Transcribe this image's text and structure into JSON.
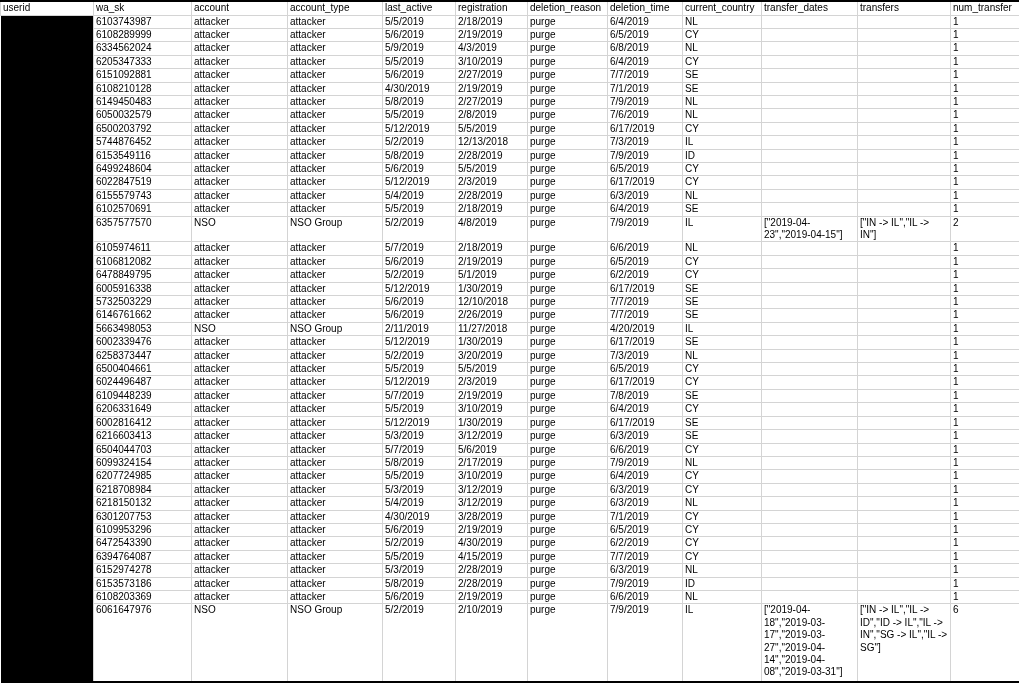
{
  "columns": [
    "userid",
    "wa_sk",
    "account",
    "account_type",
    "last_active",
    "registration",
    "deletion_reason",
    "deletion_time",
    "current_country",
    "transfer_dates",
    "transfers",
    "num_transfer"
  ],
  "rows": [
    {
      "wa_sk": "6103743987",
      "account": "attacker",
      "account_type": "attacker",
      "last_active": "5/5/2019",
      "registration": "2/18/2019",
      "deletion_reason": "purge",
      "deletion_time": "6/4/2019",
      "current_country": "NL",
      "num_transfer": "1"
    },
    {
      "wa_sk": "6108289999",
      "account": "attacker",
      "account_type": "attacker",
      "last_active": "5/6/2019",
      "registration": "2/19/2019",
      "deletion_reason": "purge",
      "deletion_time": "6/5/2019",
      "current_country": "CY",
      "num_transfer": "1"
    },
    {
      "wa_sk": "6334562024",
      "account": "attacker",
      "account_type": "attacker",
      "last_active": "5/9/2019",
      "registration": "4/3/2019",
      "deletion_reason": "purge",
      "deletion_time": "6/8/2019",
      "current_country": "NL",
      "num_transfer": "1"
    },
    {
      "wa_sk": "6205347333",
      "account": "attacker",
      "account_type": "attacker",
      "last_active": "5/5/2019",
      "registration": "3/10/2019",
      "deletion_reason": "purge",
      "deletion_time": "6/4/2019",
      "current_country": "CY",
      "num_transfer": "1"
    },
    {
      "wa_sk": "6151092881",
      "account": "attacker",
      "account_type": "attacker",
      "last_active": "5/6/2019",
      "registration": "2/27/2019",
      "deletion_reason": "purge",
      "deletion_time": "7/7/2019",
      "current_country": "SE",
      "num_transfer": "1"
    },
    {
      "wa_sk": "6108210128",
      "account": "attacker",
      "account_type": "attacker",
      "last_active": "4/30/2019",
      "registration": "2/19/2019",
      "deletion_reason": "purge",
      "deletion_time": "7/1/2019",
      "current_country": "SE",
      "num_transfer": "1"
    },
    {
      "wa_sk": "6149450483",
      "account": "attacker",
      "account_type": "attacker",
      "last_active": "5/8/2019",
      "registration": "2/27/2019",
      "deletion_reason": "purge",
      "deletion_time": "7/9/2019",
      "current_country": "NL",
      "num_transfer": "1"
    },
    {
      "wa_sk": "6050032579",
      "account": "attacker",
      "account_type": "attacker",
      "last_active": "5/5/2019",
      "registration": "2/8/2019",
      "deletion_reason": "purge",
      "deletion_time": "7/6/2019",
      "current_country": "NL",
      "num_transfer": "1"
    },
    {
      "wa_sk": "6500203792",
      "account": "attacker",
      "account_type": "attacker",
      "last_active": "5/12/2019",
      "registration": "5/5/2019",
      "deletion_reason": "purge",
      "deletion_time": "6/17/2019",
      "current_country": "CY",
      "num_transfer": "1"
    },
    {
      "wa_sk": "5744876452",
      "account": "attacker",
      "account_type": "attacker",
      "last_active": "5/2/2019",
      "registration": "12/13/2018",
      "deletion_reason": "purge",
      "deletion_time": "7/3/2019",
      "current_country": "IL",
      "num_transfer": "1"
    },
    {
      "wa_sk": "6153549116",
      "account": "attacker",
      "account_type": "attacker",
      "last_active": "5/8/2019",
      "registration": "2/28/2019",
      "deletion_reason": "purge",
      "deletion_time": "7/9/2019",
      "current_country": "ID",
      "num_transfer": "1"
    },
    {
      "wa_sk": "6499248604",
      "account": "attacker",
      "account_type": "attacker",
      "last_active": "5/6/2019",
      "registration": "5/5/2019",
      "deletion_reason": "purge",
      "deletion_time": "6/5/2019",
      "current_country": "CY",
      "num_transfer": "1"
    },
    {
      "wa_sk": "6022847519",
      "account": "attacker",
      "account_type": "attacker",
      "last_active": "5/12/2019",
      "registration": "2/3/2019",
      "deletion_reason": "purge",
      "deletion_time": "6/17/2019",
      "current_country": "CY",
      "num_transfer": "1"
    },
    {
      "wa_sk": "6155579743",
      "account": "attacker",
      "account_type": "attacker",
      "last_active": "5/4/2019",
      "registration": "2/28/2019",
      "deletion_reason": "purge",
      "deletion_time": "6/3/2019",
      "current_country": "NL",
      "num_transfer": "1"
    },
    {
      "wa_sk": "6102570691",
      "account": "attacker",
      "account_type": "attacker",
      "last_active": "5/5/2019",
      "registration": "2/18/2019",
      "deletion_reason": "purge",
      "deletion_time": "6/4/2019",
      "current_country": "SE",
      "num_transfer": "1"
    },
    {
      "wa_sk": "6357577570",
      "account": "NSO",
      "account_type": "NSO Group",
      "last_active": "5/2/2019",
      "registration": "4/8/2019",
      "deletion_reason": "purge",
      "deletion_time": "7/9/2019",
      "current_country": "IL",
      "transfer_dates": "[\"2019-04-23\",\"2019-04-15\"]",
      "transfers": "[\"IN -> IL\",\"IL -> IN\"]",
      "num_transfer": "2"
    },
    {
      "wa_sk": "6105974611",
      "account": "attacker",
      "account_type": "attacker",
      "last_active": "5/7/2019",
      "registration": "2/18/2019",
      "deletion_reason": "purge",
      "deletion_time": "6/6/2019",
      "current_country": "NL",
      "num_transfer": "1"
    },
    {
      "wa_sk": "6106812082",
      "account": "attacker",
      "account_type": "attacker",
      "last_active": "5/6/2019",
      "registration": "2/19/2019",
      "deletion_reason": "purge",
      "deletion_time": "6/5/2019",
      "current_country": "CY",
      "num_transfer": "1"
    },
    {
      "wa_sk": "6478849795",
      "account": "attacker",
      "account_type": "attacker",
      "last_active": "5/2/2019",
      "registration": "5/1/2019",
      "deletion_reason": "purge",
      "deletion_time": "6/2/2019",
      "current_country": "CY",
      "num_transfer": "1"
    },
    {
      "wa_sk": "6005916338",
      "account": "attacker",
      "account_type": "attacker",
      "last_active": "5/12/2019",
      "registration": "1/30/2019",
      "deletion_reason": "purge",
      "deletion_time": "6/17/2019",
      "current_country": "SE",
      "num_transfer": "1"
    },
    {
      "wa_sk": "5732503229",
      "account": "attacker",
      "account_type": "attacker",
      "last_active": "5/6/2019",
      "registration": "12/10/2018",
      "deletion_reason": "purge",
      "deletion_time": "7/7/2019",
      "current_country": "SE",
      "num_transfer": "1"
    },
    {
      "wa_sk": "6146761662",
      "account": "attacker",
      "account_type": "attacker",
      "last_active": "5/6/2019",
      "registration": "2/26/2019",
      "deletion_reason": "purge",
      "deletion_time": "7/7/2019",
      "current_country": "SE",
      "num_transfer": "1"
    },
    {
      "wa_sk": "5663498053",
      "account": "NSO",
      "account_type": "NSO Group",
      "last_active": "2/11/2019",
      "registration": "11/27/2018",
      "deletion_reason": "purge",
      "deletion_time": "4/20/2019",
      "current_country": "IL",
      "num_transfer": "1"
    },
    {
      "wa_sk": "6002339476",
      "account": "attacker",
      "account_type": "attacker",
      "last_active": "5/12/2019",
      "registration": "1/30/2019",
      "deletion_reason": "purge",
      "deletion_time": "6/17/2019",
      "current_country": "SE",
      "num_transfer": "1"
    },
    {
      "wa_sk": "6258373447",
      "account": "attacker",
      "account_type": "attacker",
      "last_active": "5/2/2019",
      "registration": "3/20/2019",
      "deletion_reason": "purge",
      "deletion_time": "7/3/2019",
      "current_country": "NL",
      "num_transfer": "1"
    },
    {
      "wa_sk": "6500404661",
      "account": "attacker",
      "account_type": "attacker",
      "last_active": "5/5/2019",
      "registration": "5/5/2019",
      "deletion_reason": "purge",
      "deletion_time": "6/5/2019",
      "current_country": "CY",
      "num_transfer": "1"
    },
    {
      "wa_sk": "6024496487",
      "account": "attacker",
      "account_type": "attacker",
      "last_active": "5/12/2019",
      "registration": "2/3/2019",
      "deletion_reason": "purge",
      "deletion_time": "6/17/2019",
      "current_country": "CY",
      "num_transfer": "1"
    },
    {
      "wa_sk": "6109448239",
      "account": "attacker",
      "account_type": "attacker",
      "last_active": "5/7/2019",
      "registration": "2/19/2019",
      "deletion_reason": "purge",
      "deletion_time": "7/8/2019",
      "current_country": "SE",
      "num_transfer": "1"
    },
    {
      "wa_sk": "6206331649",
      "account": "attacker",
      "account_type": "attacker",
      "last_active": "5/5/2019",
      "registration": "3/10/2019",
      "deletion_reason": "purge",
      "deletion_time": "6/4/2019",
      "current_country": "CY",
      "num_transfer": "1"
    },
    {
      "wa_sk": "6002816412",
      "account": "attacker",
      "account_type": "attacker",
      "last_active": "5/12/2019",
      "registration": "1/30/2019",
      "deletion_reason": "purge",
      "deletion_time": "6/17/2019",
      "current_country": "SE",
      "num_transfer": "1"
    },
    {
      "wa_sk": "6216603413",
      "account": "attacker",
      "account_type": "attacker",
      "last_active": "5/3/2019",
      "registration": "3/12/2019",
      "deletion_reason": "purge",
      "deletion_time": "6/3/2019",
      "current_country": "SE",
      "num_transfer": "1"
    },
    {
      "wa_sk": "6504044703",
      "account": "attacker",
      "account_type": "attacker",
      "last_active": "5/7/2019",
      "registration": "5/6/2019",
      "deletion_reason": "purge",
      "deletion_time": "6/6/2019",
      "current_country": "CY",
      "num_transfer": "1"
    },
    {
      "wa_sk": "6099324154",
      "account": "attacker",
      "account_type": "attacker",
      "last_active": "5/8/2019",
      "registration": "2/17/2019",
      "deletion_reason": "purge",
      "deletion_time": "7/9/2019",
      "current_country": "NL",
      "num_transfer": "1"
    },
    {
      "wa_sk": "6207724985",
      "account": "attacker",
      "account_type": "attacker",
      "last_active": "5/5/2019",
      "registration": "3/10/2019",
      "deletion_reason": "purge",
      "deletion_time": "6/4/2019",
      "current_country": "CY",
      "num_transfer": "1"
    },
    {
      "wa_sk": "6218708984",
      "account": "attacker",
      "account_type": "attacker",
      "last_active": "5/3/2019",
      "registration": "3/12/2019",
      "deletion_reason": "purge",
      "deletion_time": "6/3/2019",
      "current_country": "CY",
      "num_transfer": "1"
    },
    {
      "wa_sk": "6218150132",
      "account": "attacker",
      "account_type": "attacker",
      "last_active": "5/4/2019",
      "registration": "3/12/2019",
      "deletion_reason": "purge",
      "deletion_time": "6/3/2019",
      "current_country": "NL",
      "num_transfer": "1"
    },
    {
      "wa_sk": "6301207753",
      "account": "attacker",
      "account_type": "attacker",
      "last_active": "4/30/2019",
      "registration": "3/28/2019",
      "deletion_reason": "purge",
      "deletion_time": "7/1/2019",
      "current_country": "CY",
      "num_transfer": "1"
    },
    {
      "wa_sk": "6109953296",
      "account": "attacker",
      "account_type": "attacker",
      "last_active": "5/6/2019",
      "registration": "2/19/2019",
      "deletion_reason": "purge",
      "deletion_time": "6/5/2019",
      "current_country": "CY",
      "num_transfer": "1"
    },
    {
      "wa_sk": "6472543390",
      "account": "attacker",
      "account_type": "attacker",
      "last_active": "5/2/2019",
      "registration": "4/30/2019",
      "deletion_reason": "purge",
      "deletion_time": "6/2/2019",
      "current_country": "CY",
      "num_transfer": "1"
    },
    {
      "wa_sk": "6394764087",
      "account": "attacker",
      "account_type": "attacker",
      "last_active": "5/5/2019",
      "registration": "4/15/2019",
      "deletion_reason": "purge",
      "deletion_time": "7/7/2019",
      "current_country": "CY",
      "num_transfer": "1"
    },
    {
      "wa_sk": "6152974278",
      "account": "attacker",
      "account_type": "attacker",
      "last_active": "5/3/2019",
      "registration": "2/28/2019",
      "deletion_reason": "purge",
      "deletion_time": "6/3/2019",
      "current_country": "NL",
      "num_transfer": "1"
    },
    {
      "wa_sk": "6153573186",
      "account": "attacker",
      "account_type": "attacker",
      "last_active": "5/8/2019",
      "registration": "2/28/2019",
      "deletion_reason": "purge",
      "deletion_time": "7/9/2019",
      "current_country": "ID",
      "num_transfer": "1"
    },
    {
      "wa_sk": "6108203369",
      "account": "attacker",
      "account_type": "attacker",
      "last_active": "5/6/2019",
      "registration": "2/19/2019",
      "deletion_reason": "purge",
      "deletion_time": "6/6/2019",
      "current_country": "NL",
      "num_transfer": "1"
    },
    {
      "wa_sk": "6061647976",
      "account": "NSO",
      "account_type": "NSO Group",
      "last_active": "5/2/2019",
      "registration": "2/10/2019",
      "deletion_reason": "purge",
      "deletion_time": "7/9/2019",
      "current_country": "IL",
      "transfer_dates": "[\"2019-04-18\",\"2019-03-17\",\"2019-03-27\",\"2019-04-14\",\"2019-04-08\",\"2019-03-31\"]",
      "transfers": "[\"IN -> IL\",\"IL -> ID\",\"ID -> IL\",\"IL -> IN\",\"SG -> IL\",\"IL -> SG\"]",
      "num_transfer": "6"
    }
  ]
}
